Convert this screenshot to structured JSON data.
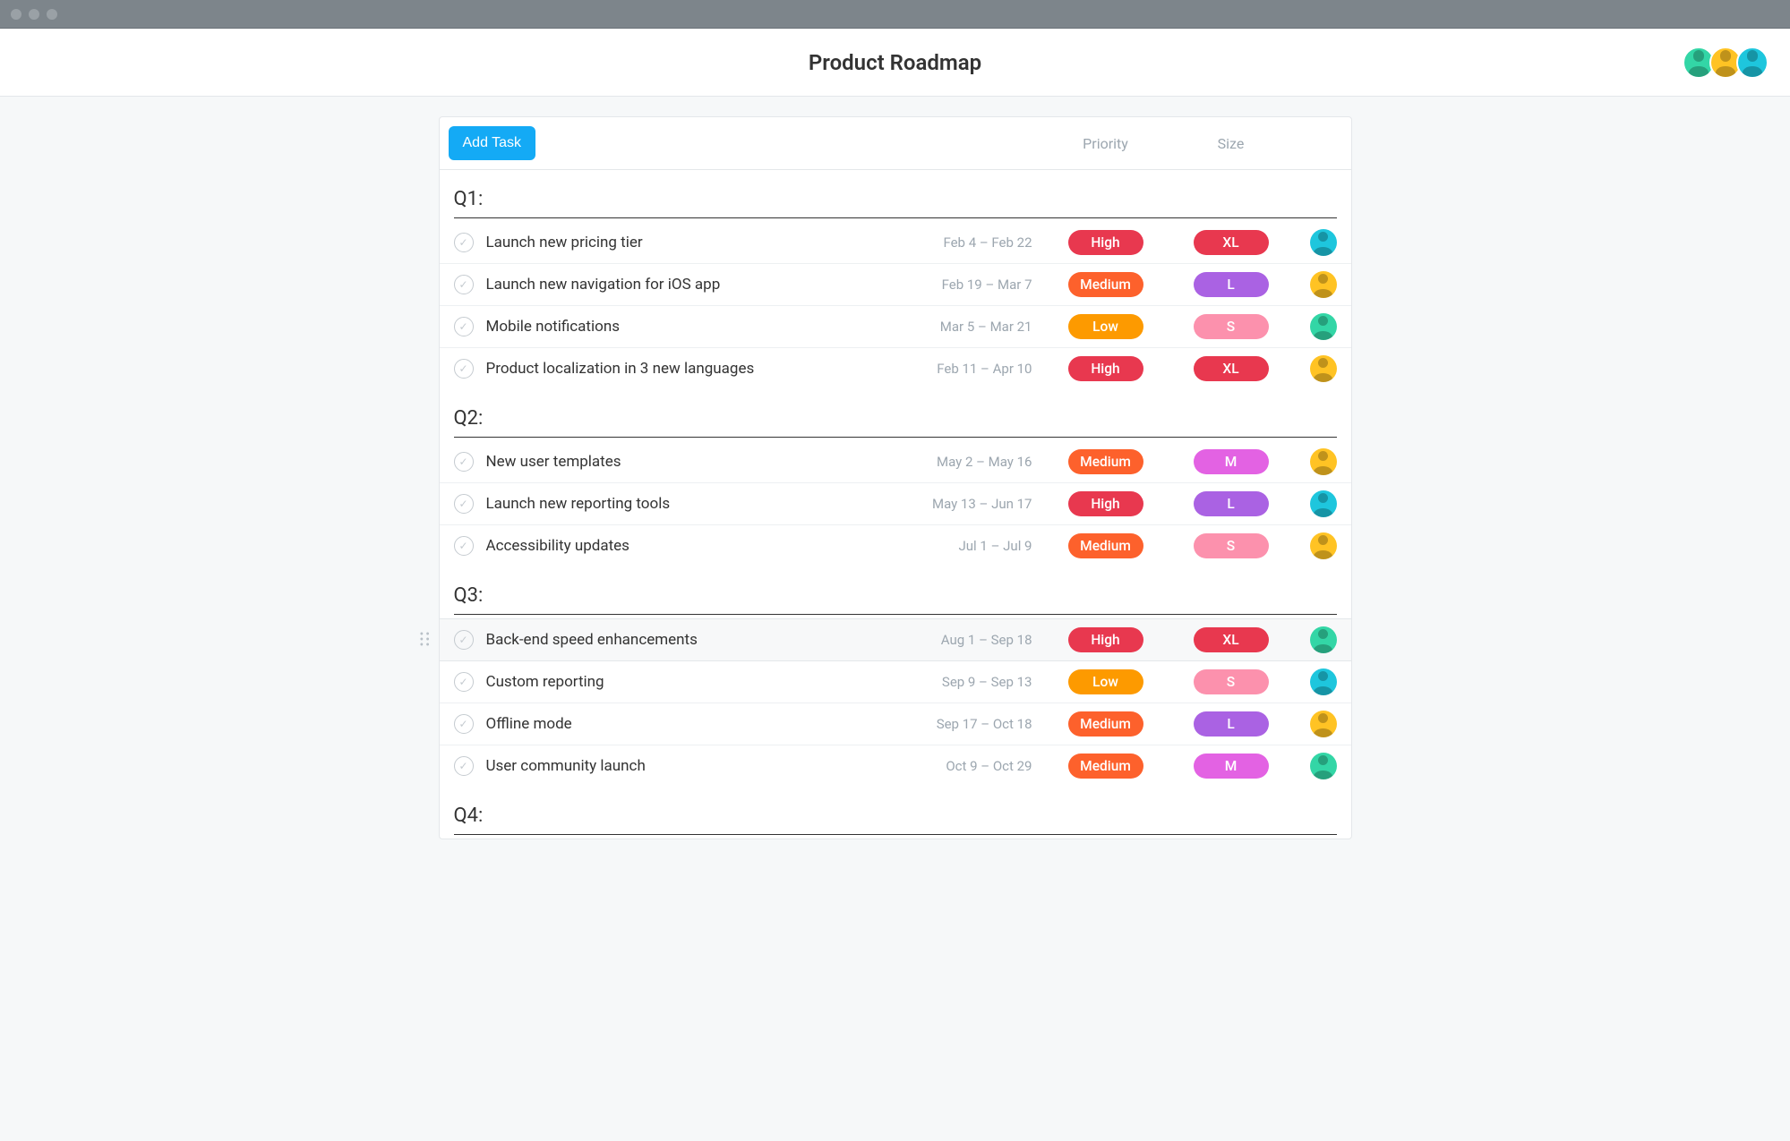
{
  "page_title": "Product Roadmap",
  "add_task_label": "Add Task",
  "columns": {
    "priority": "Priority",
    "size": "Size"
  },
  "header_avatars": [
    {
      "color": "a-green"
    },
    {
      "color": "a-yellow"
    },
    {
      "color": "a-cyan"
    }
  ],
  "pill_colors": {
    "High": "c-red",
    "Medium": "c-orange",
    "Low": "c-yellow",
    "XL": "c-red",
    "L": "c-purple",
    "M": "c-magenta",
    "S": "c-pink"
  },
  "sections": [
    {
      "name": "Q1:",
      "tasks": [
        {
          "title": "Launch new pricing tier",
          "date": "Feb 4 – Feb 22",
          "priority": "High",
          "size": "XL",
          "avatar": "a-cyan"
        },
        {
          "title": "Launch new navigation for iOS app",
          "date": "Feb 19 – Mar 7",
          "priority": "Medium",
          "size": "L",
          "avatar": "a-yellow"
        },
        {
          "title": "Mobile notifications",
          "date": "Mar 5 – Mar 21",
          "priority": "Low",
          "size": "S",
          "avatar": "a-green"
        },
        {
          "title": "Product localization in 3 new languages",
          "date": "Feb 11 – Apr 10",
          "priority": "High",
          "size": "XL",
          "avatar": "a-yellow"
        }
      ]
    },
    {
      "name": "Q2:",
      "tasks": [
        {
          "title": "New user templates",
          "date": "May 2 – May 16",
          "priority": "Medium",
          "size": "M",
          "avatar": "a-yellow"
        },
        {
          "title": "Launch new reporting tools",
          "date": "May 13 – Jun 17",
          "priority": "High",
          "size": "L",
          "avatar": "a-cyan"
        },
        {
          "title": "Accessibility updates",
          "date": "Jul 1 – Jul 9",
          "priority": "Medium",
          "size": "S",
          "avatar": "a-yellow"
        }
      ]
    },
    {
      "name": "Q3:",
      "tasks": [
        {
          "title": "Back-end speed enhancements",
          "date": "Aug 1 – Sep 18",
          "priority": "High",
          "size": "XL",
          "avatar": "a-green",
          "hovered": true
        },
        {
          "title": "Custom reporting",
          "date": "Sep 9 – Sep 13",
          "priority": "Low",
          "size": "S",
          "avatar": "a-cyan"
        },
        {
          "title": "Offline mode",
          "date": "Sep 17 – Oct 18",
          "priority": "Medium",
          "size": "L",
          "avatar": "a-yellow"
        },
        {
          "title": "User community launch",
          "date": "Oct 9 – Oct 29",
          "priority": "Medium",
          "size": "M",
          "avatar": "a-green"
        }
      ]
    },
    {
      "name": "Q4:",
      "tasks": []
    }
  ]
}
